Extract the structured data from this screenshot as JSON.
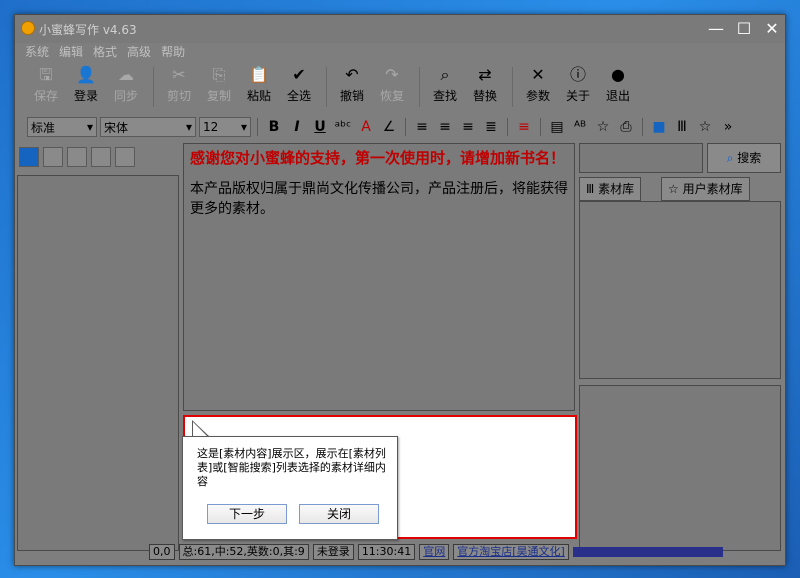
{
  "window": {
    "title": "小蜜蜂写作 v4.63",
    "minimize_glyph": "—",
    "maximize_glyph": "☐",
    "close_glyph": "✕"
  },
  "menu": [
    "系统",
    "编辑",
    "格式",
    "高级",
    "帮助"
  ],
  "toolbar": [
    {
      "icon": "save-icon",
      "glyph": "🖫",
      "label": "保存",
      "enabled": false
    },
    {
      "icon": "login-icon",
      "glyph": "👤",
      "label": "登录",
      "enabled": true
    },
    {
      "icon": "sync-icon",
      "glyph": "☁",
      "label": "同步",
      "enabled": false
    },
    {
      "icon": "cut-icon",
      "glyph": "✂",
      "label": "剪切",
      "enabled": false
    },
    {
      "icon": "copy-icon",
      "glyph": "⎘",
      "label": "复制",
      "enabled": false
    },
    {
      "icon": "paste-icon",
      "glyph": "📋",
      "label": "粘贴",
      "enabled": true
    },
    {
      "icon": "select-all-icon",
      "glyph": "✔",
      "label": "全选",
      "enabled": true
    },
    {
      "icon": "undo-icon",
      "glyph": "↶",
      "label": "撤销",
      "enabled": true
    },
    {
      "icon": "redo-icon",
      "glyph": "↷",
      "label": "恢复",
      "enabled": false
    },
    {
      "icon": "find-icon",
      "glyph": "⌕",
      "label": "查找",
      "enabled": true
    },
    {
      "icon": "replace-icon",
      "glyph": "⇄",
      "label": "替换",
      "enabled": true
    },
    {
      "icon": "settings-icon",
      "glyph": "✕",
      "label": "参数",
      "enabled": true
    },
    {
      "icon": "about-icon",
      "glyph": "ⓘ",
      "label": "关于",
      "enabled": true
    },
    {
      "icon": "exit-icon",
      "glyph": "●",
      "label": "退出",
      "enabled": true
    }
  ],
  "format": {
    "style_value": "标准",
    "font_value": "宋体",
    "size_value": "12",
    "buttons": [
      {
        "name": "bold-button",
        "glyph": "B"
      },
      {
        "name": "italic-button",
        "glyph": "I"
      },
      {
        "name": "underline-button",
        "glyph": "U"
      },
      {
        "name": "strikethrough-button",
        "glyph": "ᵃᵇᶜ"
      },
      {
        "name": "font-color-button",
        "glyph": "A"
      },
      {
        "name": "highlight-button",
        "glyph": "∠"
      },
      {
        "name": "align-left-button",
        "glyph": "≡"
      },
      {
        "name": "align-center-button",
        "glyph": "≡"
      },
      {
        "name": "align-right-button",
        "glyph": "≡"
      },
      {
        "name": "justify-button",
        "glyph": "≣"
      },
      {
        "name": "line-style-button",
        "glyph": "≡"
      },
      {
        "name": "layout-button",
        "glyph": "▤"
      },
      {
        "name": "spellcheck-button",
        "glyph": "ᴬᴮ"
      },
      {
        "name": "favorite-button",
        "glyph": "☆"
      },
      {
        "name": "print-button",
        "glyph": "⎙"
      },
      {
        "name": "view-mode-button",
        "glyph": "■"
      },
      {
        "name": "library-button",
        "glyph": "Ⅲ"
      },
      {
        "name": "star-button",
        "glyph": "☆"
      },
      {
        "name": "more-button",
        "glyph": "»"
      }
    ]
  },
  "editor": {
    "title": "感谢您对小蜜蜂的支持，第一次使用时，请增加新书名！",
    "body": "本产品版权归属于鼎尚文化传播公司，产品注册后，将能获得更多的素材。"
  },
  "right": {
    "search_placeholder": "",
    "search_button": "搜索",
    "tab_library": "素材库",
    "tab_user_library": "用户素材库"
  },
  "tooltip": {
    "text": "这是[素材内容]展示区，展示在[素材列表]或[智能搜索]列表选择的素材详细内容",
    "next_button": "下一步",
    "close_button": "关闭"
  },
  "status": {
    "coords": "0,0",
    "counts": "总:61,中:52,英数:0,其:9",
    "login": "未登录",
    "time": "11:30:41",
    "website": "官网",
    "shop": "官方淘宝店[昊通文化]"
  }
}
